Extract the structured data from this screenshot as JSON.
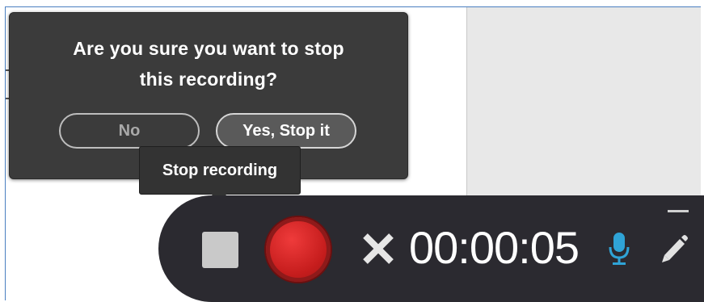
{
  "confirm_dialog": {
    "message": "Are you sure you want to stop\nthis recording?",
    "no_label": "No",
    "yes_label": "Yes, Stop it"
  },
  "tooltip": {
    "text": "Stop recording"
  },
  "recorder": {
    "timer": "00:00:05",
    "icons": {
      "stop": "stop-icon",
      "record": "record-icon",
      "close": "close-icon",
      "mic": "microphone-icon",
      "pencil": "pencil-icon",
      "minimize": "minimize-icon"
    },
    "colors": {
      "bar": "#2b2a30",
      "record_red": "#c61d1d",
      "mic_blue": "#2fa3d6"
    }
  }
}
